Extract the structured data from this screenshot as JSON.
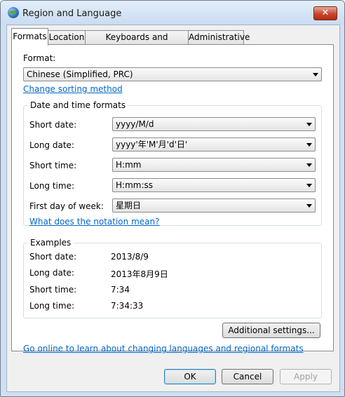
{
  "window": {
    "title": "Region and Language",
    "close_glyph": "✕"
  },
  "tabs": [
    {
      "label": "Formats"
    },
    {
      "label": "Location"
    },
    {
      "label": "Keyboards and Languages"
    },
    {
      "label": "Administrative"
    }
  ],
  "formats": {
    "format_label": "Format:",
    "format_value": "Chinese (Simplified, PRC)",
    "sorting_link": "Change sorting method",
    "group_title": "Date and time formats",
    "rows": [
      {
        "label": "Short date:",
        "value": "yyyy/M/d"
      },
      {
        "label": "Long date:",
        "value": "yyyy'年'M'月'd'日'"
      },
      {
        "label": "Short time:",
        "value": "H:mm"
      },
      {
        "label": "Long time:",
        "value": "H:mm:ss"
      },
      {
        "label": "First day of week:",
        "value": "星期日"
      }
    ],
    "notation_link": "What does the notation mean?",
    "examples": {
      "title": "Examples",
      "rows": [
        {
          "label": "Short date:",
          "value": "2013/8/9"
        },
        {
          "label": "Long date:",
          "value": "2013年8月9日"
        },
        {
          "label": "Short time:",
          "value": "7:34"
        },
        {
          "label": "Long time:",
          "value": "7:34:33"
        }
      ]
    },
    "additional_settings": "Additional settings...",
    "online_link": "Go online to learn about changing languages and regional formats"
  },
  "buttons": {
    "ok": "OK",
    "cancel": "Cancel",
    "apply": "Apply"
  }
}
